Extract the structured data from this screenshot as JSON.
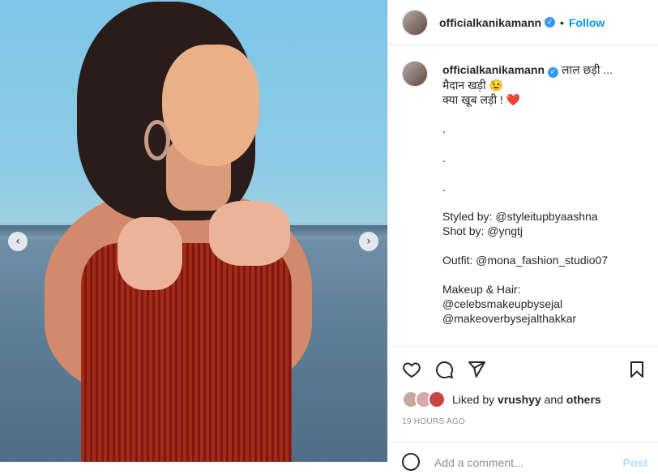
{
  "post": {
    "username": "officialkanikamann",
    "verified_icon": "verified-badge-icon",
    "follow_label": "Follow",
    "dot": "•"
  },
  "caption": {
    "username": "officialkanikamann",
    "text": "लाल छड़ी ...\nमैदान खड़ी 😉\nक्या खूब लड़ी ! ❤️\n\n.\n\n.\n\n.\n\nStyled by: @styleitupbyaashna\nShot by: @yngtj\n\nOutfit: @mona_fashion_studio07\n\nMakeup & Hair:\n@celebsmakeupbysejal\n@makeoverbysejalthakkar"
  },
  "likes": {
    "prefix": "Liked by",
    "user": "vrushyy",
    "and": "and",
    "others": "others"
  },
  "timestamp": "19 HOURS AGO",
  "comment": {
    "placeholder": "Add a comment...",
    "post_label": "Post"
  },
  "carousel": {
    "prev": "‹",
    "next": "›"
  },
  "colors": {
    "link": "#0095f6",
    "verified": "#3897f0",
    "dress": "#a52a1c"
  }
}
